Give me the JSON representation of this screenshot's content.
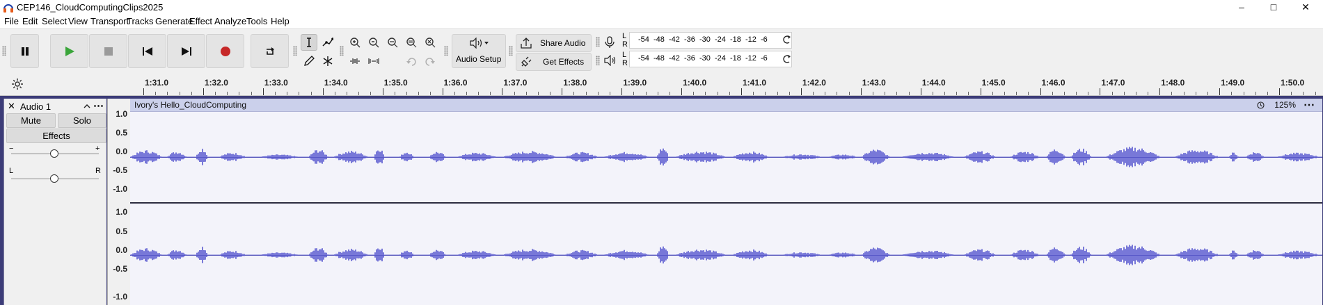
{
  "window": {
    "title": "CEP146_CloudComputingClips2025",
    "controls": {
      "minimize": "–",
      "maximize": "□",
      "close": "✕"
    }
  },
  "menu": [
    "File",
    "Edit",
    "Select",
    "View",
    "Transport",
    "Tracks",
    "Generate",
    "Effect",
    "Analyze",
    "Tools",
    "Help"
  ],
  "transport": {
    "buttons": [
      "pause-icon",
      "play-icon",
      "stop-icon",
      "skip-start-icon",
      "skip-end-icon",
      "record-icon",
      "loop-icon"
    ],
    "accent": {
      "play": "#3aa53a",
      "record": "#c62828"
    }
  },
  "tools": {
    "audio_setup_label": "Audio Setup",
    "share_audio_label": "Share Audio",
    "get_effects_label": "Get Effects"
  },
  "meters": {
    "record_lr": [
      "L",
      "R"
    ],
    "play_lr": [
      "L",
      "R"
    ],
    "scale": [
      "-54",
      "-48",
      "-42",
      "-36",
      "-30",
      "-24",
      "-18",
      "-12",
      "-6"
    ]
  },
  "ruler": {
    "labels": [
      "1:31.0",
      "1:32.0",
      "1:33.0",
      "1:34.0",
      "1:35.0",
      "1:36.0",
      "1:37.0",
      "1:38.0",
      "1:39.0",
      "1:40.0",
      "1:41.0",
      "1:42.0",
      "1:43.0",
      "1:44.0",
      "1:45.0",
      "1:46.0",
      "1:47.0",
      "1:48.0",
      "1:49.0",
      "1:50.0"
    ]
  },
  "track": {
    "name": "Audio 1",
    "mute_label": "Mute",
    "solo_label": "Solo",
    "effects_label": "Effects",
    "gain_minus": "−",
    "gain_plus": "+",
    "pan_left": "L",
    "pan_right": "R",
    "scale_labels": [
      "1.0",
      "0.5",
      "0.0",
      "-0.5",
      "-1.0"
    ]
  },
  "clip": {
    "name": "Ivory's Hello_CloudComputing",
    "zoom": "125%",
    "menu": "⋯",
    "wave_color": "#5a5ad0"
  }
}
